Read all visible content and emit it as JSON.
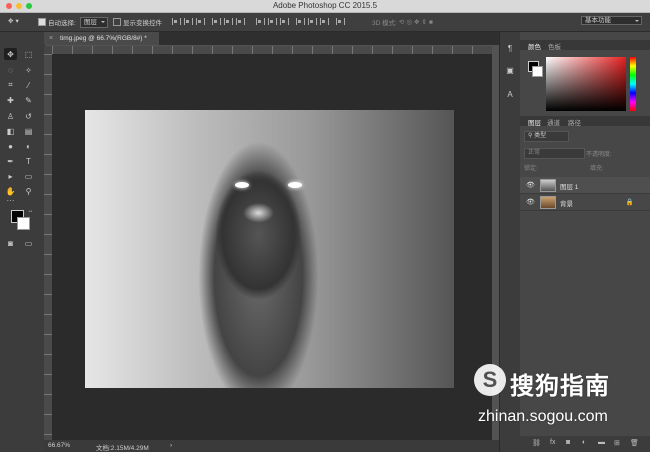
{
  "app": {
    "title": "Adobe Photoshop CC 2015.5"
  },
  "optionsbar": {
    "auto_select_label": "自动选择:",
    "auto_select_value": "图层",
    "show_transform_label": "显示变换控件",
    "mode_3d_label": "3D 模式:",
    "workspace": "基本功能"
  },
  "document": {
    "tab_close": "×",
    "tab_title": "timg.jpeg @ 66.7%(RGB/8#) *"
  },
  "status": {
    "zoom": "66.67%",
    "doc_size": "文档:2.15M/4.29M",
    "arrow": "›"
  },
  "panels": {
    "color_tabs": [
      "颜色",
      "色板"
    ],
    "layers_tabs": [
      "图层",
      "通道",
      "路径"
    ],
    "filter_kind": "类型",
    "blend_mode": "正常",
    "opacity_label": "不透明度:",
    "lock_label": "锁定:",
    "fill_label": "填充:",
    "layers": [
      {
        "name": "图层 1",
        "locked": false
      },
      {
        "name": "背景",
        "locked": true
      }
    ],
    "bottom_icons": [
      "link-icon",
      "fx-icon",
      "mask-icon",
      "adjustment-icon",
      "folder-icon",
      "new-layer-icon",
      "trash-icon"
    ]
  },
  "watermark": {
    "cn": "搜狗指南",
    "en": "zhinan.sogou.com"
  },
  "colors": {
    "accent_red": "#e62020",
    "panel_bg": "#474747",
    "canvas_bg": "#2b2b2b"
  }
}
